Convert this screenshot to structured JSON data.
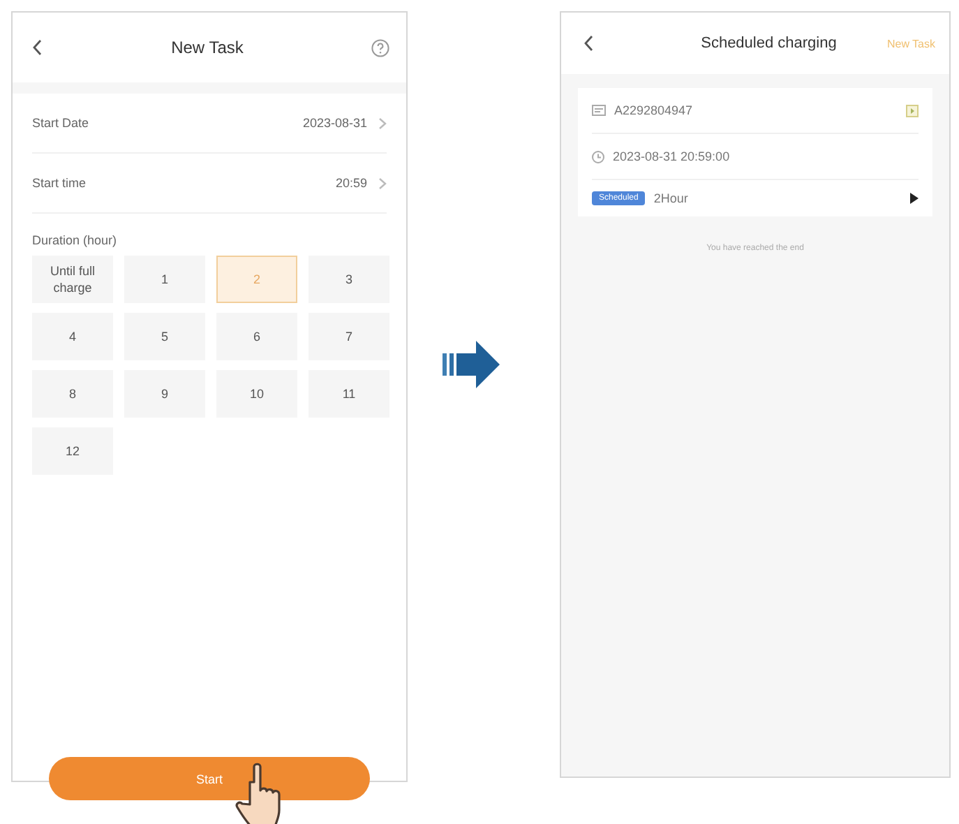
{
  "new_task": {
    "title": "New Task",
    "fields": [
      {
        "label": "Start Date",
        "value": "2023-08-31"
      },
      {
        "label": "Start time",
        "value": "20:59"
      }
    ],
    "duration_label": "Duration (hour)",
    "durations": [
      {
        "label": "Until full charge",
        "selected": false
      },
      {
        "label": "1",
        "selected": false
      },
      {
        "label": "2",
        "selected": true
      },
      {
        "label": "3",
        "selected": false
      },
      {
        "label": "4",
        "selected": false
      },
      {
        "label": "5",
        "selected": false
      },
      {
        "label": "6",
        "selected": false
      },
      {
        "label": "7",
        "selected": false
      },
      {
        "label": "8",
        "selected": false
      },
      {
        "label": "9",
        "selected": false
      },
      {
        "label": "10",
        "selected": false
      },
      {
        "label": "11",
        "selected": false
      },
      {
        "label": "12",
        "selected": false
      }
    ],
    "start_button": "Start"
  },
  "scheduled": {
    "title": "Scheduled charging",
    "action": "New Task",
    "task": {
      "device_id": "A2292804947",
      "time": "2023-08-31 20:59:00",
      "status": "Scheduled",
      "duration": "2Hour"
    },
    "end_note": "You have reached the end"
  }
}
